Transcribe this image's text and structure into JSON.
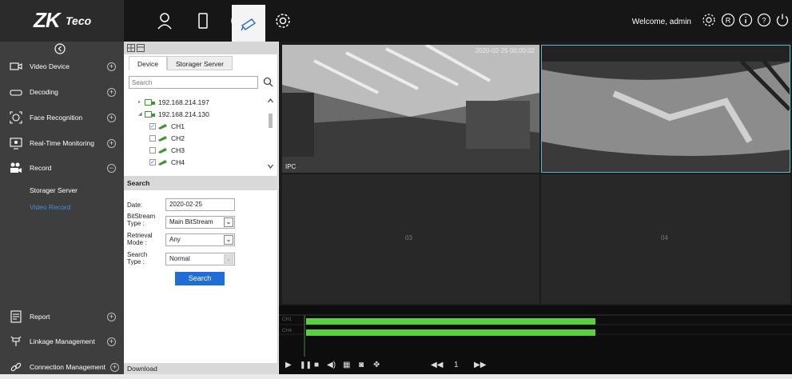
{
  "header": {
    "logo_main": "ZK",
    "logo_sub": "Teco",
    "welcome_text": "Welcome, admin",
    "nav_icons": [
      "person-icon",
      "door-icon",
      "clock-icon",
      "camera-icon",
      "gear-icon"
    ],
    "right_icons": [
      "settings-icon",
      "registered-icon",
      "info-icon",
      "help-icon",
      "power-icon"
    ]
  },
  "sidebar": {
    "items": [
      {
        "label": "Video Device",
        "icon": "monitor-icon",
        "expander": "+"
      },
      {
        "label": "Decoding",
        "icon": "decoder-icon",
        "expander": "+"
      },
      {
        "label": "Face Recognition",
        "icon": "face-icon",
        "expander": "+"
      },
      {
        "label": "Real-Time Monitoring",
        "icon": "screen-icon",
        "expander": "+"
      },
      {
        "label": "Record",
        "icon": "video-camera-icon",
        "expander": "−"
      }
    ],
    "sub_items": [
      "Storager Server",
      "Video Record"
    ],
    "bottom_items": [
      {
        "label": "Report",
        "icon": "report-icon",
        "expander": "+"
      },
      {
        "label": "Linkage Management",
        "icon": "linkage-icon",
        "expander": "+"
      },
      {
        "label": "Connection Management",
        "icon": "link-icon",
        "expander": "+"
      }
    ]
  },
  "panel": {
    "tabs": [
      "Device",
      "Storager Server"
    ],
    "search_placeholder": "Search",
    "tree": [
      {
        "label": "192.168.214.197",
        "type": "device",
        "expanded": false
      },
      {
        "label": "192.168.214.130",
        "type": "device",
        "expanded": true
      },
      {
        "label": "CH1",
        "type": "channel",
        "checked": true
      },
      {
        "label": "CH2",
        "type": "channel",
        "checked": false
      },
      {
        "label": "CH3",
        "type": "channel",
        "checked": false
      },
      {
        "label": "CH4",
        "type": "channel",
        "checked": true
      }
    ],
    "search_section": {
      "title": "Search",
      "date_label": "Date:",
      "date_value": "2020-02-25",
      "bitstream_label": "BitStream Type :",
      "bitstream_value": "Main BitStream",
      "retrieval_label": "Retrieval Mode :",
      "retrieval_value": "Any",
      "search_type_label": "Search Type :",
      "search_type_value": "Normal",
      "button": "Search"
    },
    "download_label": "Download"
  },
  "video": {
    "cell1_timestamp": "2020-02-25 00:00:02",
    "cell1_label": "IPC",
    "cell3_label": "03",
    "cell4_label": "04",
    "timeline_rows": [
      "CH1",
      "CH4"
    ],
    "playback_speed": "1"
  },
  "colors": {
    "accent": "#1f6dd6",
    "record_bar": "#5bce44",
    "active_subitem": "#3f8fe0"
  }
}
